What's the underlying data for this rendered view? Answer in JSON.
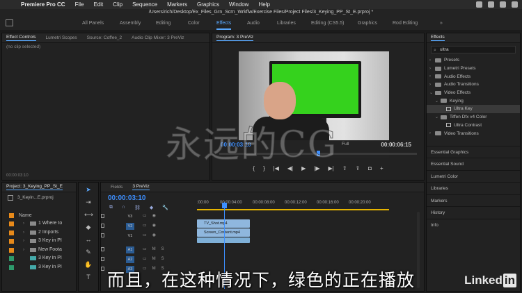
{
  "menubar": {
    "app_name": "Premiere Pro CC",
    "items": [
      "File",
      "Edit",
      "Clip",
      "Sequence",
      "Markers",
      "Graphics",
      "Window",
      "Help"
    ]
  },
  "path": "/Users/rich/Desktop/Ex_Files_Grn_Scrn_Wrkflw/Exercise Files/Project Files/3_Keying_PP_St_E.prproj *",
  "workspaces": {
    "tabs": [
      "All Panels",
      "Assembly",
      "Editing",
      "Color",
      "Effects",
      "Audio",
      "Libraries",
      "Editing (CS5.5)",
      "Graphics",
      "Rod Editing"
    ],
    "active": "Effects"
  },
  "effect_controls": {
    "tabs": [
      "Effect Controls",
      "Lumetri Scopes",
      "Source: Coffee_2",
      "Audio Clip Mixer: 3 PreViz"
    ],
    "status": "(no clip selected)",
    "timecode": "00:00:03:10"
  },
  "program": {
    "title": "Program: 3 PreViz",
    "timecode": "00:00:03:10",
    "fit": "Full",
    "duration": "00:00:06:15"
  },
  "effects": {
    "title": "Effects",
    "search_value": "ultra",
    "items": [
      {
        "label": "Presets",
        "level": 0
      },
      {
        "label": "Lumetri Presets",
        "level": 0
      },
      {
        "label": "Audio Effects",
        "level": 0
      },
      {
        "label": "Audio Transitions",
        "level": 0
      },
      {
        "label": "Video Effects",
        "level": 0
      },
      {
        "label": "Keying",
        "level": 1
      },
      {
        "label": "Ultra Key",
        "level": 2
      },
      {
        "label": "Tiffen Dfx v4 Color",
        "level": 1
      },
      {
        "label": "Ultra Contrast",
        "level": 2
      },
      {
        "label": "Video Transitions",
        "level": 0
      }
    ],
    "panels": [
      "Essential Graphics",
      "Essential Sound",
      "Lumetri Color",
      "Libraries",
      "Markers",
      "History",
      "Info"
    ]
  },
  "project": {
    "title": "Project: 3_Keying_PP_St_E",
    "file": "3_Keyin...E.prproj",
    "name_header": "Name",
    "rows": [
      {
        "label": "1 Where to",
        "color": "#e88a1a"
      },
      {
        "label": "2 Imports",
        "color": "#e88a1a"
      },
      {
        "label": "3 Key in PI",
        "color": "#e88a1a"
      },
      {
        "label": "New Foota",
        "color": "#e88a1a"
      },
      {
        "label": "3 Key in PI",
        "color": "#2e9a6c"
      },
      {
        "label": "3 Key in PI",
        "color": "#2e9a6c"
      }
    ]
  },
  "timeline": {
    "tabs": [
      "Fields",
      "3 PreViz"
    ],
    "timecode": "00:00:03:10",
    "ruler": [
      ":00:00",
      "00:00:04:00",
      "00:00:08:00",
      "00:00:12:00",
      "00:00:16:00",
      "00:00:20:00"
    ],
    "tracks": [
      "V3",
      "V2",
      "V1",
      "A1",
      "A2",
      "A3"
    ],
    "clips": {
      "v2": "TV_Shot.mp4",
      "v1": "Screen_Content.mp4"
    }
  },
  "overlay": {
    "watermark": "永远的CG",
    "subtitle": "而且，在这种情况下，绿色的正在播放",
    "brand": "Linked",
    "brand_in": "in"
  }
}
